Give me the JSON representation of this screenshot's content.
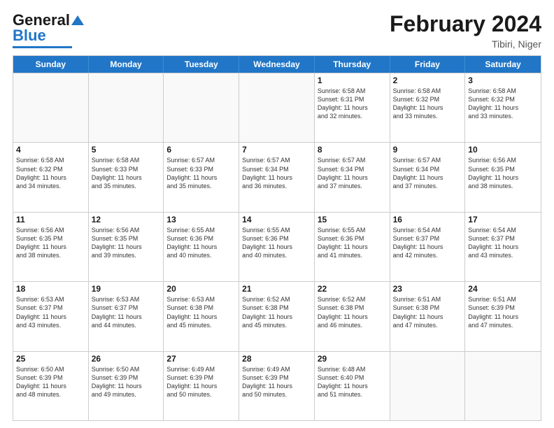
{
  "header": {
    "logo_general": "General",
    "logo_blue": "Blue",
    "title": "February 2024",
    "subtitle": "Tibiri, Niger"
  },
  "days_of_week": [
    "Sunday",
    "Monday",
    "Tuesday",
    "Wednesday",
    "Thursday",
    "Friday",
    "Saturday"
  ],
  "weeks": [
    [
      {
        "day": "",
        "info": ""
      },
      {
        "day": "",
        "info": ""
      },
      {
        "day": "",
        "info": ""
      },
      {
        "day": "",
        "info": ""
      },
      {
        "day": "1",
        "info": "Sunrise: 6:58 AM\nSunset: 6:31 PM\nDaylight: 11 hours\nand 32 minutes."
      },
      {
        "day": "2",
        "info": "Sunrise: 6:58 AM\nSunset: 6:32 PM\nDaylight: 11 hours\nand 33 minutes."
      },
      {
        "day": "3",
        "info": "Sunrise: 6:58 AM\nSunset: 6:32 PM\nDaylight: 11 hours\nand 33 minutes."
      }
    ],
    [
      {
        "day": "4",
        "info": "Sunrise: 6:58 AM\nSunset: 6:32 PM\nDaylight: 11 hours\nand 34 minutes."
      },
      {
        "day": "5",
        "info": "Sunrise: 6:58 AM\nSunset: 6:33 PM\nDaylight: 11 hours\nand 35 minutes."
      },
      {
        "day": "6",
        "info": "Sunrise: 6:57 AM\nSunset: 6:33 PM\nDaylight: 11 hours\nand 35 minutes."
      },
      {
        "day": "7",
        "info": "Sunrise: 6:57 AM\nSunset: 6:34 PM\nDaylight: 11 hours\nand 36 minutes."
      },
      {
        "day": "8",
        "info": "Sunrise: 6:57 AM\nSunset: 6:34 PM\nDaylight: 11 hours\nand 37 minutes."
      },
      {
        "day": "9",
        "info": "Sunrise: 6:57 AM\nSunset: 6:34 PM\nDaylight: 11 hours\nand 37 minutes."
      },
      {
        "day": "10",
        "info": "Sunrise: 6:56 AM\nSunset: 6:35 PM\nDaylight: 11 hours\nand 38 minutes."
      }
    ],
    [
      {
        "day": "11",
        "info": "Sunrise: 6:56 AM\nSunset: 6:35 PM\nDaylight: 11 hours\nand 38 minutes."
      },
      {
        "day": "12",
        "info": "Sunrise: 6:56 AM\nSunset: 6:35 PM\nDaylight: 11 hours\nand 39 minutes."
      },
      {
        "day": "13",
        "info": "Sunrise: 6:55 AM\nSunset: 6:36 PM\nDaylight: 11 hours\nand 40 minutes."
      },
      {
        "day": "14",
        "info": "Sunrise: 6:55 AM\nSunset: 6:36 PM\nDaylight: 11 hours\nand 40 minutes."
      },
      {
        "day": "15",
        "info": "Sunrise: 6:55 AM\nSunset: 6:36 PM\nDaylight: 11 hours\nand 41 minutes."
      },
      {
        "day": "16",
        "info": "Sunrise: 6:54 AM\nSunset: 6:37 PM\nDaylight: 11 hours\nand 42 minutes."
      },
      {
        "day": "17",
        "info": "Sunrise: 6:54 AM\nSunset: 6:37 PM\nDaylight: 11 hours\nand 43 minutes."
      }
    ],
    [
      {
        "day": "18",
        "info": "Sunrise: 6:53 AM\nSunset: 6:37 PM\nDaylight: 11 hours\nand 43 minutes."
      },
      {
        "day": "19",
        "info": "Sunrise: 6:53 AM\nSunset: 6:37 PM\nDaylight: 11 hours\nand 44 minutes."
      },
      {
        "day": "20",
        "info": "Sunrise: 6:53 AM\nSunset: 6:38 PM\nDaylight: 11 hours\nand 45 minutes."
      },
      {
        "day": "21",
        "info": "Sunrise: 6:52 AM\nSunset: 6:38 PM\nDaylight: 11 hours\nand 45 minutes."
      },
      {
        "day": "22",
        "info": "Sunrise: 6:52 AM\nSunset: 6:38 PM\nDaylight: 11 hours\nand 46 minutes."
      },
      {
        "day": "23",
        "info": "Sunrise: 6:51 AM\nSunset: 6:38 PM\nDaylight: 11 hours\nand 47 minutes."
      },
      {
        "day": "24",
        "info": "Sunrise: 6:51 AM\nSunset: 6:39 PM\nDaylight: 11 hours\nand 47 minutes."
      }
    ],
    [
      {
        "day": "25",
        "info": "Sunrise: 6:50 AM\nSunset: 6:39 PM\nDaylight: 11 hours\nand 48 minutes."
      },
      {
        "day": "26",
        "info": "Sunrise: 6:50 AM\nSunset: 6:39 PM\nDaylight: 11 hours\nand 49 minutes."
      },
      {
        "day": "27",
        "info": "Sunrise: 6:49 AM\nSunset: 6:39 PM\nDaylight: 11 hours\nand 50 minutes."
      },
      {
        "day": "28",
        "info": "Sunrise: 6:49 AM\nSunset: 6:39 PM\nDaylight: 11 hours\nand 50 minutes."
      },
      {
        "day": "29",
        "info": "Sunrise: 6:48 AM\nSunset: 6:40 PM\nDaylight: 11 hours\nand 51 minutes."
      },
      {
        "day": "",
        "info": ""
      },
      {
        "day": "",
        "info": ""
      }
    ]
  ]
}
